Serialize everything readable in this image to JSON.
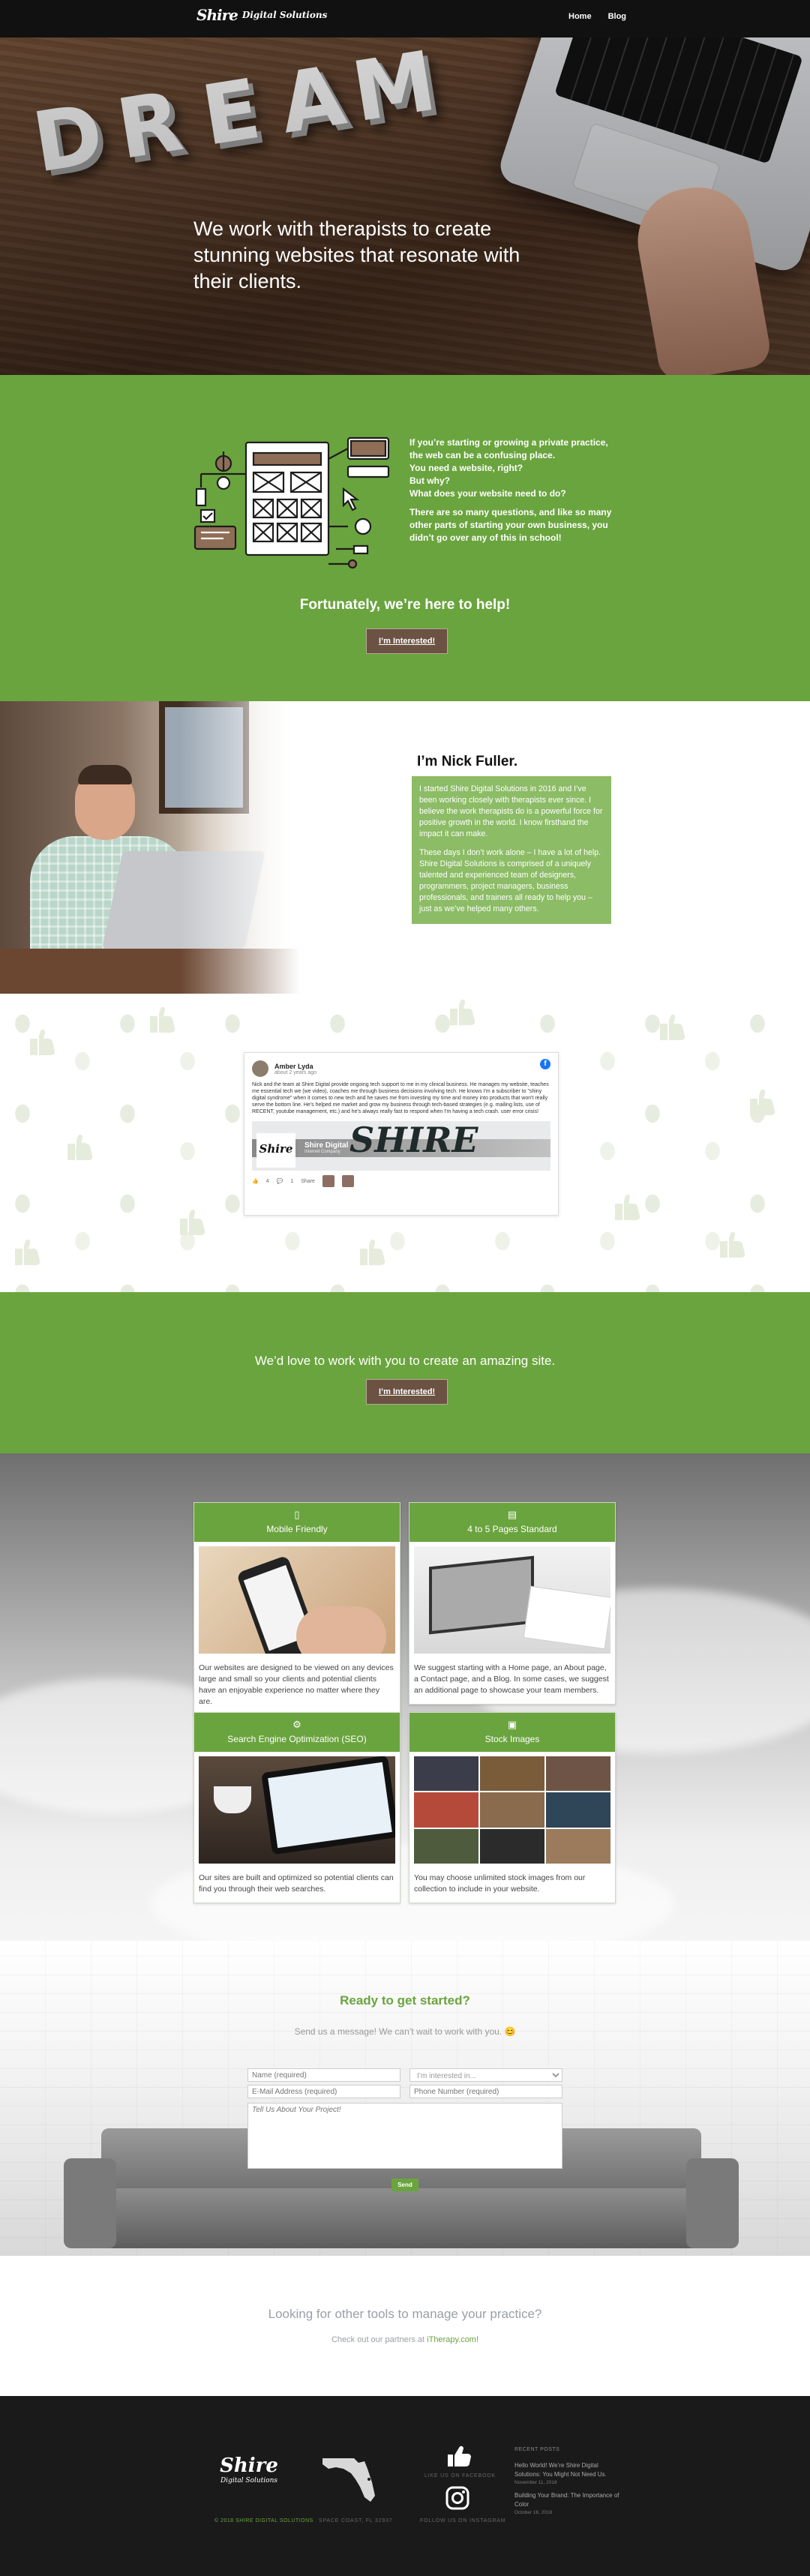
{
  "header": {
    "logo_mark": "Shire",
    "logo_sub": "Digital Solutions",
    "nav": [
      "Home",
      "Blog"
    ]
  },
  "hero": {
    "dream_letters": [
      "D",
      "R",
      "E",
      "A",
      "M"
    ],
    "headline": "We work with therapists to create stunning websites that resonate with their clients."
  },
  "intro": {
    "lines": [
      "If you’re starting or growing a private practice, the web can be a confusing place.",
      "You need a website, right?",
      "But why?",
      "What does your website need to do?"
    ],
    "para2": "There are so many questions, and like so many other parts of starting your own business, you didn’t go over any of this in school!",
    "help_title": "Fortunately, we’re here to help!",
    "button": "I’m Interested!"
  },
  "about": {
    "title": "I’m Nick Fuller.",
    "p1": "I started Shire Digital Solutions in 2016 and I’ve been working closely with therapists ever since. I believe the work therapists do is a powerful force for positive growth in the world. I know firsthand the impact it can make.",
    "p2": "These days I don’t work alone – I have a lot of help. Shire Digital Solutions is comprised of a uniquely talented and experienced team of designers, programmers, project managers, business professionals, and trainers all ready to help you – just as we’ve helped many others."
  },
  "testimonial": {
    "name": "Amber Lyda",
    "date": "about 2 years ago",
    "fb_glyph": "f",
    "text": "Nick and the team at Shire Digital provide ongoing tech support to me in my clinical business. He manages my website, teaches me essential tech we (we video), coaches me through business decisions involving tech. He knows I'm a subscriber to \"shiny digital syndrome\" when it comes to new tech and he saves me from investing my time and money into products that won't really serve the bottom line. He's helped me market and grow my business through tech-based strategies (e.g. mailing lists, use of RECENT, youtube management, etc.) and he's always really fast to respond when I'm having a tech crash. user error crisis!",
    "page_title": "Shire Digital",
    "page_sub": "Internet Company",
    "banner_text": "SHIRE",
    "mini_logo": "Shire",
    "reactions": "4",
    "comments": "1",
    "share": "Share"
  },
  "cta": {
    "title": "We’d love to work with you to create an amazing site.",
    "button": "I’m Interested!"
  },
  "features": [
    {
      "icon": "▯",
      "title": "Mobile Friendly",
      "text": "Our websites are designed to be viewed on any devices large and small so your clients and potential clients have an enjoyable experience no matter where they are."
    },
    {
      "icon": "▤",
      "title": "4 to 5 Pages Standard",
      "text": "We suggest starting with a Home page, an About page, a Contact page, and a Blog. In some cases, we suggest an additional page to showcase your team members."
    },
    {
      "icon": "⚙",
      "title": "Search Engine Optimization (SEO)",
      "text": "Our sites are built and optimized so potential clients can find you through their web searches."
    },
    {
      "icon": "▣",
      "title": "Stock Images",
      "text": "You may choose unlimited stock images from our collection to include in your website."
    }
  ],
  "contact": {
    "title": "Ready to get started?",
    "subtitle": "Send us a message! We can’t wait to work with you. 😊",
    "name_placeholder": "Name (required)",
    "interest_value": "I’m interested in...",
    "email_placeholder": "E-Mail Address (required)",
    "phone_placeholder": "Phone Number (required)",
    "project_placeholder": "Tell Us About Your Project!",
    "send": "Send"
  },
  "partners": {
    "title": "Looking for other tools to manage your practice?",
    "text_prefix": "Check out our partners at ",
    "link": "iTherapy.com!"
  },
  "footer": {
    "logo_big": "Shire",
    "logo_small": "Digital Solutions",
    "copyright": "© 2018 Shire Digital Solutions",
    "space_coast": "Space Coast, FL 32937",
    "like_us": "Like us on Facebook",
    "follow_us": "Follow us on Instagram",
    "recent_title": "Recent Posts",
    "posts": [
      {
        "title": "Hello World! We’re Shire Digital Solutions: You Might Not Need Us.",
        "date": "November 11, 2018"
      },
      {
        "title": "Building Your Brand: The Importance of Color",
        "date": "October 16, 2018"
      }
    ]
  },
  "colors": {
    "brand_green": "#6aa43e",
    "button_brown": "#6b5242",
    "footer_bg": "#1a1a1b"
  }
}
